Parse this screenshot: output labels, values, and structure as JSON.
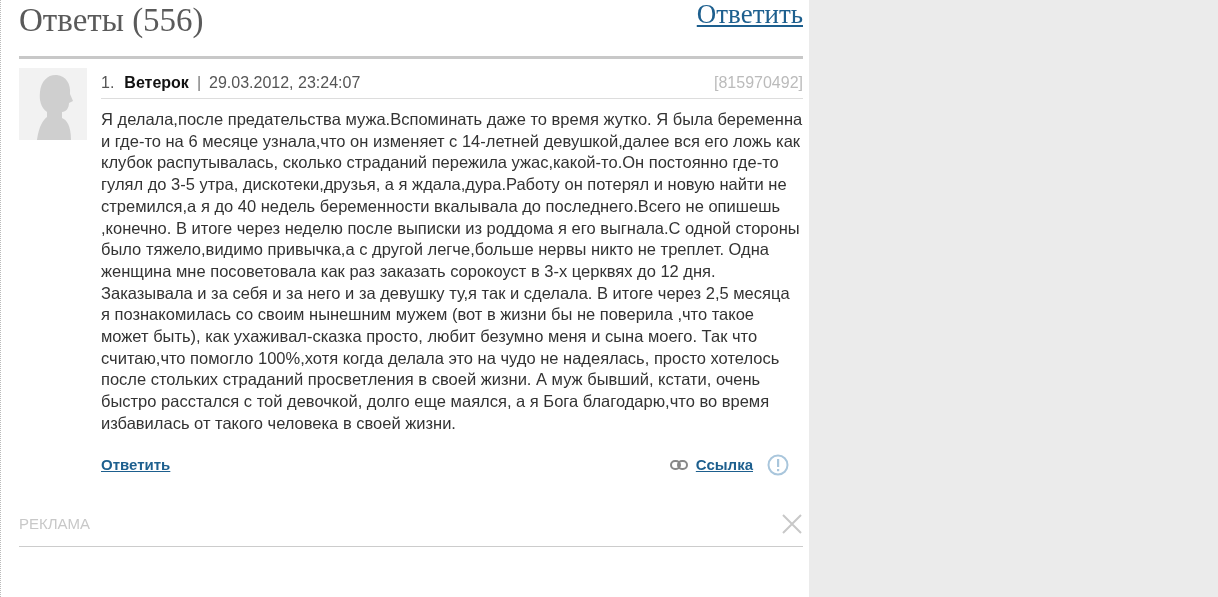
{
  "header": {
    "title": "Ответы (556)",
    "reply_link": "Ответить"
  },
  "answers": [
    {
      "number": "1.",
      "author": "Ветерок",
      "separator": "|",
      "date": "29.03.2012, 23:24:07",
      "id": "[815970492]",
      "text": "Я делала,после предательства мужа.Вспоминать даже то время жутко. Я была беременна и где-то на 6 месяце узнала,что он изменяет с 14-летней девушкой,далее вся его ложь как клубок распутывалась, сколько страданий пережила ужас,какой-то.Он постоянно где-то гулял до 3-5 утра, дискотеки,друзья, а я ждала,дура.Работу он потерял и новую найти не стремился,а я до 40 недель беременности вкалывала до последнего.Всего не опишешь ,конечно. В итоге через неделю после выписки из роддома я его выгнала.С одной стороны было тяжело,видимо привычка,а с другой легче,больше нервы никто не треплет. Одна женщина мне посоветовала как раз заказать сорокоуст в 3-х церквях до 12 дня. Заказывала и за себя и за него и за девушку ту,я так и сделала. В итоге через 2,5 месяца я познакомилась со своим нынешним мужем (вот в жизни бы не поверила ,что такое может быть), как ухаживал-сказка просто, любит безумно меня и сына моего. Так что считаю,что помогло 100%,хотя когда делала это на чудо не надеялась, просто хотелось после стольких страданий просветления в своей жизни. А муж бывший, кстати, очень быстро расстался с той девочкой, долго еще маялся, а я Бога благодарю,что во время избавилась от такого человека в своей жизни.",
      "reply": "Ответить",
      "link": "Ссылка"
    }
  ],
  "ad": {
    "label": "РЕКЛАМА"
  }
}
